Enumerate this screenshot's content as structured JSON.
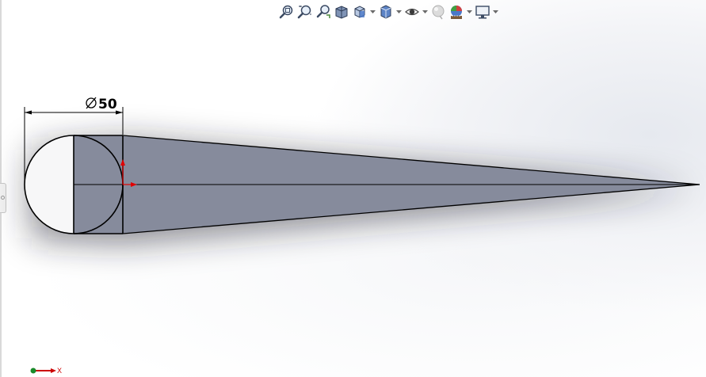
{
  "toolbar": {
    "items": [
      {
        "name": "zoom-to-fit-icon",
        "has_dropdown": false
      },
      {
        "name": "zoom-to-area-icon",
        "has_dropdown": false
      },
      {
        "name": "previous-view-icon",
        "has_dropdown": false
      },
      {
        "name": "section-view-icon",
        "has_dropdown": false
      },
      {
        "name": "view-orientation-icon",
        "has_dropdown": true
      },
      {
        "name": "display-style-icon",
        "has_dropdown": true
      },
      {
        "name": "hide-show-items-icon",
        "has_dropdown": true
      },
      {
        "name": "edit-appearance-icon",
        "has_dropdown": false
      },
      {
        "name": "apply-scene-icon",
        "has_dropdown": true
      },
      {
        "name": "view-settings-icon",
        "has_dropdown": true
      }
    ]
  },
  "dimension": {
    "label": "50",
    "symbol": "diameter"
  },
  "triad": {
    "x_label": "X"
  },
  "colors": {
    "face_fill": "#868b9c",
    "sketch_line": "#000000",
    "origin_red": "#e00000",
    "triad_green": "#1a8a2a"
  }
}
